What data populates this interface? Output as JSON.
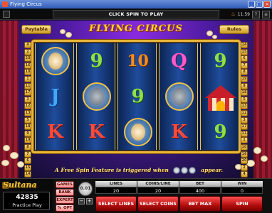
{
  "window": {
    "title": "Flying Circus"
  },
  "topbar": {
    "prompt": "CLICK SPIN TO PLAY",
    "clock": "11:59"
  },
  "header": {
    "paytable": "Paytable",
    "rules": "Rules",
    "game_title": "FLYING CIRCUS"
  },
  "paylines": {
    "left": [
      "4",
      "2",
      "20",
      "16",
      "10",
      "1",
      "11",
      "17",
      "3",
      "12",
      "13",
      "5",
      "18",
      "9",
      "19",
      "8",
      "7",
      "6",
      "15",
      "14"
    ],
    "right": [
      "14",
      "15",
      "6",
      "7",
      "8",
      "19",
      "9",
      "18",
      "5",
      "13",
      "12",
      "3",
      "17",
      "11",
      "1",
      "10",
      "16",
      "20",
      "2",
      "4"
    ]
  },
  "reels": [
    [
      {
        "type": "lion"
      },
      {
        "type": "letter",
        "text": "J",
        "cls": "sym-J"
      },
      {
        "type": "letter",
        "text": "K",
        "cls": "sym-K"
      }
    ],
    [
      {
        "type": "letter",
        "text": "9",
        "cls": "sym-9"
      },
      {
        "type": "elephant"
      },
      {
        "type": "letter",
        "text": "K",
        "cls": "sym-K"
      }
    ],
    [
      {
        "type": "letter",
        "text": "10",
        "cls": "sym-10"
      },
      {
        "type": "letter",
        "text": "9",
        "cls": "sym-9"
      },
      {
        "type": "lion"
      }
    ],
    [
      {
        "type": "letter",
        "text": "Q",
        "cls": "sym-Q"
      },
      {
        "type": "elephant"
      },
      {
        "type": "letter",
        "text": "K",
        "cls": "sym-K"
      }
    ],
    [
      {
        "type": "letter",
        "text": "9",
        "cls": "sym-9"
      },
      {
        "type": "tent"
      },
      {
        "type": "letter",
        "text": "9",
        "cls": "sym-9"
      }
    ]
  ],
  "feature": {
    "before": "A Free Spin Feature is triggered when",
    "after": "appear."
  },
  "brand": {
    "logo": "Sultana",
    "balance": "42835",
    "mode": "Practice Play"
  },
  "side_buttons": {
    "games": "GAMES",
    "bank": "BANK",
    "expert": "EXPERT",
    "percent": "%",
    "opt": "OPT"
  },
  "coin": {
    "value": "0.01",
    "minus": "−",
    "plus": "+"
  },
  "stats": {
    "lines": {
      "label": "LINES",
      "value": "20"
    },
    "coins_per_line": {
      "label": "COINS/LINE",
      "value": "20"
    },
    "bet": {
      "label": "BET",
      "value": "400"
    },
    "win": {
      "label": "WIN",
      "value": "0"
    }
  },
  "buttons": {
    "select_lines": "SELECT LINES",
    "select_coins": "SELECT COINS",
    "bet_max": "BET MAX",
    "spin": "SPIN"
  },
  "colors": {
    "gold": "#e7b53a",
    "red_button": "#b20e0e",
    "title_gold": "#ffd23a"
  }
}
